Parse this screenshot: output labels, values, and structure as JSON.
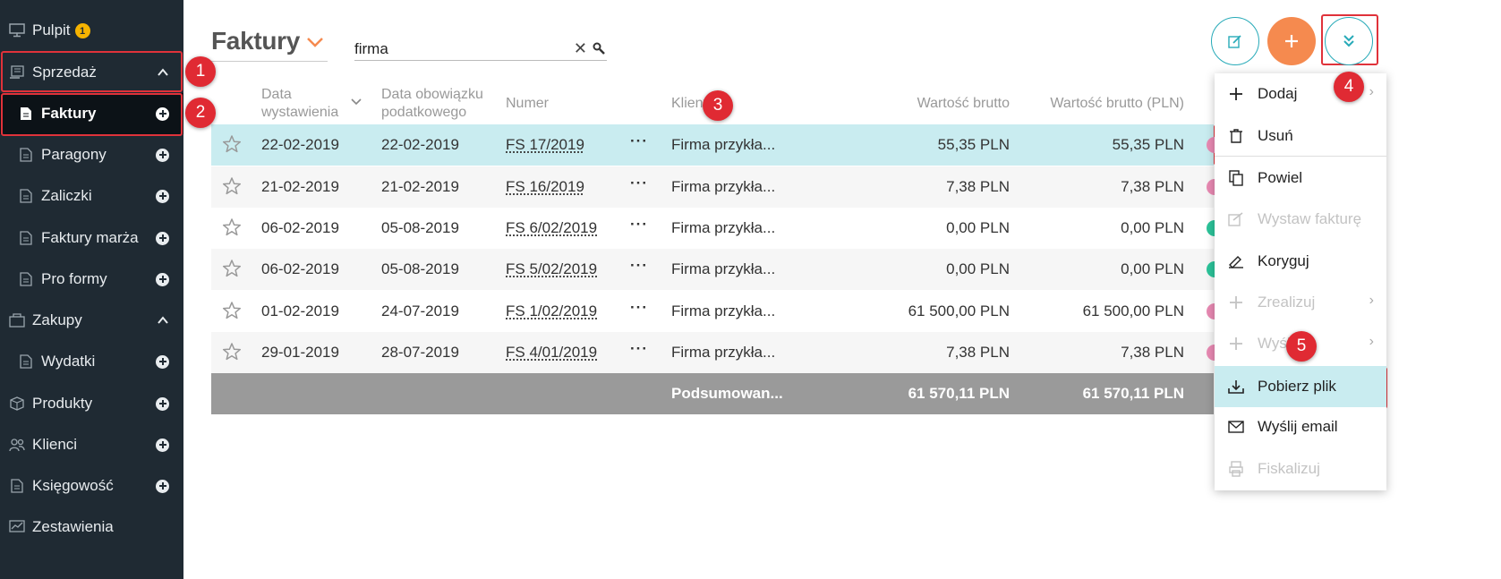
{
  "sidebar": {
    "items": [
      {
        "label": "Pulpit",
        "badge": "1"
      },
      {
        "label": "Sprzedaż"
      },
      {
        "label": "Faktury"
      },
      {
        "label": "Paragony"
      },
      {
        "label": "Zaliczki"
      },
      {
        "label": "Faktury marża"
      },
      {
        "label": "Pro formy"
      },
      {
        "label": "Zakupy"
      },
      {
        "label": "Wydatki"
      },
      {
        "label": "Produkty"
      },
      {
        "label": "Klienci"
      },
      {
        "label": "Księgowość"
      },
      {
        "label": "Zestawienia"
      }
    ]
  },
  "header": {
    "title": "Faktury",
    "search_value": "firma",
    "clear_glyph": "✕"
  },
  "table": {
    "headers": {
      "date_issued_1": "Data",
      "date_issued_2": "wystawienia",
      "tax_date_1": "Data obowiązku",
      "tax_date_2": "podatkowego",
      "number": "Numer",
      "client": "Klient",
      "gross": "Wartość brutto",
      "gross_pln": "Wartość brutto (PLN)"
    },
    "rows": [
      {
        "date": "22-02-2019",
        "tax_date": "22-02-2019",
        "number": "FS 17/2019",
        "more": "···",
        "client": "Firma przykła...",
        "gross": "55,35 PLN",
        "gross_pln": "55,35 PLN",
        "status_color": "#e98ab3"
      },
      {
        "date": "21-02-2019",
        "tax_date": "21-02-2019",
        "number": "FS 16/2019",
        "more": "···",
        "client": "Firma przykła...",
        "gross": "7,38 PLN",
        "gross_pln": "7,38 PLN",
        "status_color": "#e98ab3"
      },
      {
        "date": "06-02-2019",
        "tax_date": "05-08-2019",
        "number": "FS 6/02/2019",
        "more": "···",
        "client": "Firma przykła...",
        "gross": "0,00 PLN",
        "gross_pln": "0,00 PLN",
        "status_color": "#2cc49a"
      },
      {
        "date": "06-02-2019",
        "tax_date": "05-08-2019",
        "number": "FS 5/02/2019",
        "more": "···",
        "client": "Firma przykła...",
        "gross": "0,00 PLN",
        "gross_pln": "0,00 PLN",
        "status_color": "#2cc49a"
      },
      {
        "date": "01-02-2019",
        "tax_date": "24-07-2019",
        "number": "FS 1/02/2019",
        "more": "···",
        "client": "Firma przykła...",
        "gross": "61 500,00 PLN",
        "gross_pln": "61 500,00 PLN",
        "status_color": "#e98ab3"
      },
      {
        "date": "29-01-2019",
        "tax_date": "28-07-2019",
        "number": "FS 4/01/2019",
        "more": "···",
        "client": "Firma przykła...",
        "gross": "7,38 PLN",
        "gross_pln": "7,38 PLN",
        "status_color": "#e98ab3"
      }
    ],
    "summary": {
      "label": "Podsumowan...",
      "gross": "61 570,11 PLN",
      "gross_pln": "61 570,11 PLN"
    }
  },
  "dropdown": {
    "items": [
      {
        "label": "Dodaj",
        "icon": "plus-icon",
        "disabled": false,
        "submenu": true
      },
      {
        "label": "Usuń",
        "icon": "trash-icon",
        "disabled": false
      },
      {
        "label": "Powiel",
        "icon": "copy-icon",
        "disabled": false
      },
      {
        "label": "Wystaw fakturę",
        "icon": "invoice-icon",
        "disabled": true
      },
      {
        "label": "Koryguj",
        "icon": "correct-icon",
        "disabled": false
      },
      {
        "label": "Zrealizuj",
        "icon": "plus-icon",
        "disabled": true,
        "submenu": true
      },
      {
        "label": "Wyślij",
        "icon": "plus-icon",
        "disabled": true,
        "submenu": true
      },
      {
        "label": "Pobierz plik",
        "icon": "download-icon",
        "disabled": false
      },
      {
        "label": "Wyślij email",
        "icon": "mail-icon",
        "disabled": false
      },
      {
        "label": "Fiskalizuj",
        "icon": "printer-icon",
        "disabled": true
      }
    ],
    "submenu_glyph": "›"
  },
  "markers": [
    "1",
    "2",
    "3",
    "4",
    "5"
  ],
  "colors": {
    "sidebar_bg": "#1f2a33",
    "accent_teal": "#27aab8",
    "accent_orange": "#f58a4f",
    "selection": "#c9ecf0",
    "annotation_red": "#e0323a"
  }
}
